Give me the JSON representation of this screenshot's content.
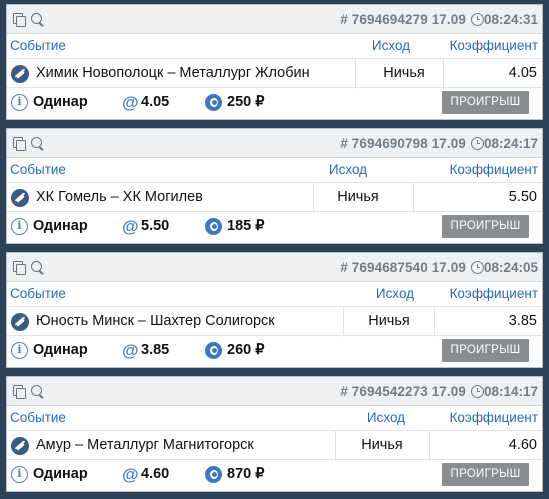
{
  "labels": {
    "event": "Событие",
    "outcome": "Исход",
    "coefficient": "Коэффициент",
    "info_icon": "i",
    "at_icon": "@"
  },
  "icons": {
    "header_left": [
      "copy-icon",
      "search-icon"
    ],
    "time": "clock-icon",
    "sport": "hockey-icon",
    "info": "info-icon",
    "coef": "at-icon",
    "stake": "coin-icon"
  },
  "colors": {
    "background": "#2b4257",
    "link_blue": "#2a6ab0",
    "status_button": "#8a8d90",
    "header_text": "#737d86"
  },
  "bets": [
    {
      "id": "# 7694694279 17.09",
      "time": "08:24:31",
      "event": "Химик Новополоцк – Металлург Жлобин",
      "outcome": "Ничья",
      "coef": "4.05",
      "type": "Одинар",
      "total_coef": "4.05",
      "stake": "250 ₽",
      "status": "ПРОИГРЫШ"
    },
    {
      "id": "# 7694690798 17.09",
      "time": "08:24:17",
      "event": "ХК Гомель – ХК Могилев",
      "outcome": "Ничья",
      "coef": "5.50",
      "type": "Одинар",
      "total_coef": "5.50",
      "stake": "185 ₽",
      "status": "ПРОИГРЫШ"
    },
    {
      "id": "# 7694687540 17.09",
      "time": "08:24:05",
      "event": "Юность Минск – Шахтер Солигорск",
      "outcome": "Ничья",
      "coef": "3.85",
      "type": "Одинар",
      "total_coef": "3.85",
      "stake": "260 ₽",
      "status": "ПРОИГРЫШ"
    },
    {
      "id": "# 7694542273 17.09",
      "time": "08:14:17",
      "event": "Амур – Металлург Магнитогорск",
      "outcome": "Ничья",
      "coef": "4.60",
      "type": "Одинар",
      "total_coef": "4.60",
      "stake": "870 ₽",
      "status": "ПРОИГРЫШ"
    }
  ]
}
